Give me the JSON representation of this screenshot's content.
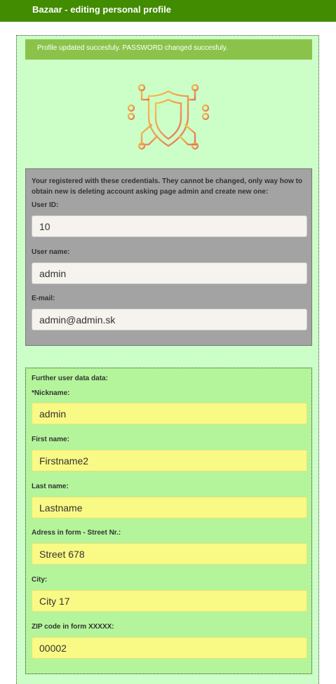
{
  "header": {
    "title": "Bazaar - editing personal profile"
  },
  "alert": {
    "message": "Profile updated succesfuly. PASSWORD changed succesfuly."
  },
  "colors": {
    "header": "#418c00",
    "alert": "#8bc34a",
    "page": "#ccffc8",
    "credentials_box": "#a3a3a3",
    "further_box": "#b4f59b",
    "editable_field": "#f9f985"
  },
  "logo": {
    "icon": "shield-circuit-icon"
  },
  "credentials": {
    "intro": "Your registered with these credentials. They cannot be changed, only way how to obtain new is deleting account asking page admin and create new one:",
    "user_id": {
      "label": "User ID:",
      "value": "10"
    },
    "user_name": {
      "label": "User name:",
      "value": "admin"
    },
    "email": {
      "label": "E-mail:",
      "value": "admin@admin.sk"
    }
  },
  "further": {
    "title": "Further user data data:",
    "nickname": {
      "label": "*Nickname:",
      "value": "admin"
    },
    "first_name": {
      "label": "First name:",
      "value": "Firstname2"
    },
    "last_name": {
      "label": "Last name:",
      "value": "Lastname"
    },
    "address": {
      "label": "Adress in form - Street Nr.:",
      "value": "Street 678"
    },
    "city": {
      "label": "City:",
      "value": "City 17"
    },
    "zip": {
      "label": "ZIP code in form XXXXX:",
      "value": "00002"
    }
  }
}
